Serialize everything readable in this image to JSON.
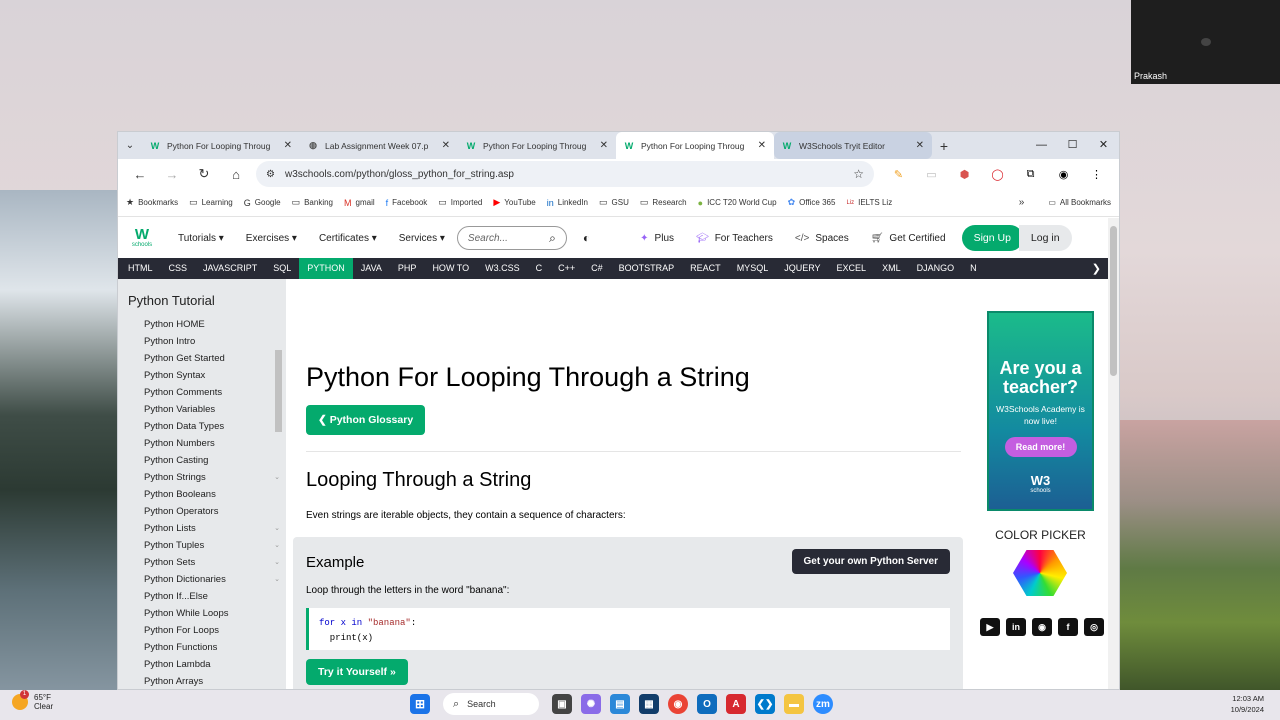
{
  "video": {
    "participant": "Prakash"
  },
  "tabs": [
    {
      "title": "Python For Looping Throug",
      "favicon": "W"
    },
    {
      "title": "Lab Assignment Week 07.p",
      "favicon": "globe"
    },
    {
      "title": "Python For Looping Throug",
      "favicon": "W"
    },
    {
      "title": "Python For Looping Throug",
      "favicon": "W"
    },
    {
      "title": "W3Schools Tryit Editor",
      "favicon": "W"
    }
  ],
  "address": {
    "url": "w3schools.com/python/gloss_python_for_string.asp"
  },
  "bookmarks": [
    {
      "label": "Bookmarks",
      "icon": "★"
    },
    {
      "label": "Learning",
      "icon": "▭"
    },
    {
      "label": "Google",
      "icon": "G"
    },
    {
      "label": "Banking",
      "icon": "▭"
    },
    {
      "label": "gmail",
      "icon": "M"
    },
    {
      "label": "Facebook",
      "icon": "f"
    },
    {
      "label": "Imported",
      "icon": "▭"
    },
    {
      "label": "YouTube",
      "icon": "▶"
    },
    {
      "label": "LinkedIn",
      "icon": "in"
    },
    {
      "label": "GSU",
      "icon": "▭"
    },
    {
      "label": "Research",
      "icon": "▭"
    },
    {
      "label": "ICC T20 World Cup",
      "icon": "●"
    },
    {
      "label": "Office 365",
      "icon": "✿"
    },
    {
      "label": "IELTS Liz",
      "icon": "Liz"
    }
  ],
  "bookmarks_right": {
    "more": "»",
    "all": "All Bookmarks"
  },
  "topnav": {
    "tutorials": "Tutorials ▾",
    "exercises": "Exercises ▾",
    "certificates": "Certificates ▾",
    "services": "Services ▾",
    "search_placeholder": "Search...",
    "plus": "Plus",
    "teachers": "For Teachers",
    "spaces": "Spaces",
    "certified": "Get Certified",
    "signup": "Sign Up",
    "login": "Log in"
  },
  "languages": [
    "HTML",
    "CSS",
    "JAVASCRIPT",
    "SQL",
    "PYTHON",
    "JAVA",
    "PHP",
    "HOW TO",
    "W3.CSS",
    "C",
    "C++",
    "C#",
    "BOOTSTRAP",
    "REACT",
    "MYSQL",
    "JQUERY",
    "EXCEL",
    "XML",
    "DJANGO",
    "N"
  ],
  "active_language": "PYTHON",
  "sidebar": {
    "title": "Python Tutorial",
    "items": [
      {
        "label": "Python HOME",
        "chev": false
      },
      {
        "label": "Python Intro",
        "chev": false
      },
      {
        "label": "Python Get Started",
        "chev": false
      },
      {
        "label": "Python Syntax",
        "chev": false
      },
      {
        "label": "Python Comments",
        "chev": false
      },
      {
        "label": "Python Variables",
        "chev": true
      },
      {
        "label": "Python Data Types",
        "chev": false
      },
      {
        "label": "Python Numbers",
        "chev": false
      },
      {
        "label": "Python Casting",
        "chev": false
      },
      {
        "label": "Python Strings",
        "chev": true
      },
      {
        "label": "Python Booleans",
        "chev": false
      },
      {
        "label": "Python Operators",
        "chev": false
      },
      {
        "label": "Python Lists",
        "chev": true
      },
      {
        "label": "Python Tuples",
        "chev": true
      },
      {
        "label": "Python Sets",
        "chev": true
      },
      {
        "label": "Python Dictionaries",
        "chev": true
      },
      {
        "label": "Python If...Else",
        "chev": false
      },
      {
        "label": "Python While Loops",
        "chev": false
      },
      {
        "label": "Python For Loops",
        "chev": false
      },
      {
        "label": "Python Functions",
        "chev": false
      },
      {
        "label": "Python Lambda",
        "chev": false
      },
      {
        "label": "Python Arrays",
        "chev": false
      }
    ]
  },
  "content": {
    "title": "Python For Looping Through a String",
    "glossary_button": "❮ Python Glossary",
    "heading": "Looping Through a String",
    "paragraph": "Even strings are iterable objects, they contain a sequence of characters:",
    "example_heading": "Example",
    "server_button": "Get your own Python Server",
    "example_text": "Loop through the letters in the word \"banana\":",
    "code_line1_a": "for x in ",
    "code_line1_b": "\"banana\"",
    "code_line1_c": ":",
    "code_line2": "  print(x)",
    "tryit_button": "Try it Yourself »"
  },
  "ad": {
    "headline": "Are you a teacher?",
    "sub": "W3Schools Academy is now live!",
    "cta": "Read more!",
    "logo": "W3",
    "logo_sub": "schools"
  },
  "color_picker": "COLOR PICKER",
  "social": [
    "▶",
    "in",
    "◉",
    "f",
    "◎"
  ],
  "taskbar": {
    "temp": "65°F",
    "condition": "Clear",
    "badge": "1",
    "search": "Search",
    "time": "12:03 AM",
    "date": "10/9/2024"
  },
  "colors": {
    "accent": "#04aa6d",
    "navbar": "#282a35",
    "sidebar": "#e7e9eb"
  }
}
